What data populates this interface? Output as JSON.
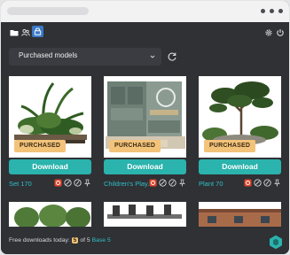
{
  "toolbar": {
    "icons": [
      "folder-icon",
      "users-icon",
      "lock-icon",
      "settings-icon",
      "power-icon"
    ]
  },
  "filter": {
    "selected": "Purchased models"
  },
  "cards": [
    {
      "name": "Set 170",
      "badge": "PURCHASED",
      "download_label": "Download"
    },
    {
      "name": "Children's Play...",
      "badge": "PURCHASED",
      "download_label": "Download"
    },
    {
      "name": "Plant 70",
      "badge": "PURCHASED",
      "download_label": "Download"
    }
  ],
  "footer": {
    "prefix": "Free downloads today:",
    "count": "5",
    "of": "of 5",
    "plan": "Base 5"
  },
  "colors": {
    "accent": "#2bb3ad",
    "link": "#2fc0c7",
    "badge": "#f3c37a",
    "active_tab": "#3b78c7",
    "background": "#2f3135"
  }
}
